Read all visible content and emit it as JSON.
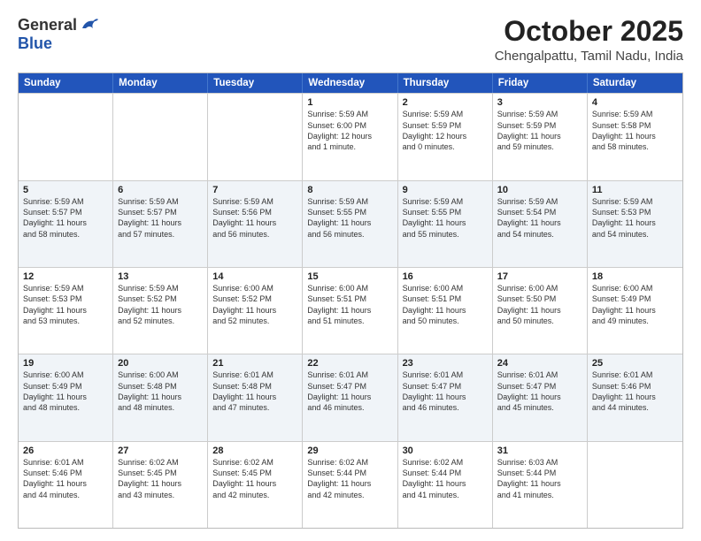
{
  "header": {
    "logo_general": "General",
    "logo_blue": "Blue",
    "month": "October 2025",
    "location": "Chengalpattu, Tamil Nadu, India"
  },
  "days_of_week": [
    "Sunday",
    "Monday",
    "Tuesday",
    "Wednesday",
    "Thursday",
    "Friday",
    "Saturday"
  ],
  "rows": [
    [
      {
        "day": "",
        "info": ""
      },
      {
        "day": "",
        "info": ""
      },
      {
        "day": "",
        "info": ""
      },
      {
        "day": "1",
        "info": "Sunrise: 5:59 AM\nSunset: 6:00 PM\nDaylight: 12 hours\nand 1 minute."
      },
      {
        "day": "2",
        "info": "Sunrise: 5:59 AM\nSunset: 5:59 PM\nDaylight: 12 hours\nand 0 minutes."
      },
      {
        "day": "3",
        "info": "Sunrise: 5:59 AM\nSunset: 5:59 PM\nDaylight: 11 hours\nand 59 minutes."
      },
      {
        "day": "4",
        "info": "Sunrise: 5:59 AM\nSunset: 5:58 PM\nDaylight: 11 hours\nand 58 minutes."
      }
    ],
    [
      {
        "day": "5",
        "info": "Sunrise: 5:59 AM\nSunset: 5:57 PM\nDaylight: 11 hours\nand 58 minutes."
      },
      {
        "day": "6",
        "info": "Sunrise: 5:59 AM\nSunset: 5:57 PM\nDaylight: 11 hours\nand 57 minutes."
      },
      {
        "day": "7",
        "info": "Sunrise: 5:59 AM\nSunset: 5:56 PM\nDaylight: 11 hours\nand 56 minutes."
      },
      {
        "day": "8",
        "info": "Sunrise: 5:59 AM\nSunset: 5:55 PM\nDaylight: 11 hours\nand 56 minutes."
      },
      {
        "day": "9",
        "info": "Sunrise: 5:59 AM\nSunset: 5:55 PM\nDaylight: 11 hours\nand 55 minutes."
      },
      {
        "day": "10",
        "info": "Sunrise: 5:59 AM\nSunset: 5:54 PM\nDaylight: 11 hours\nand 54 minutes."
      },
      {
        "day": "11",
        "info": "Sunrise: 5:59 AM\nSunset: 5:53 PM\nDaylight: 11 hours\nand 54 minutes."
      }
    ],
    [
      {
        "day": "12",
        "info": "Sunrise: 5:59 AM\nSunset: 5:53 PM\nDaylight: 11 hours\nand 53 minutes."
      },
      {
        "day": "13",
        "info": "Sunrise: 5:59 AM\nSunset: 5:52 PM\nDaylight: 11 hours\nand 52 minutes."
      },
      {
        "day": "14",
        "info": "Sunrise: 6:00 AM\nSunset: 5:52 PM\nDaylight: 11 hours\nand 52 minutes."
      },
      {
        "day": "15",
        "info": "Sunrise: 6:00 AM\nSunset: 5:51 PM\nDaylight: 11 hours\nand 51 minutes."
      },
      {
        "day": "16",
        "info": "Sunrise: 6:00 AM\nSunset: 5:51 PM\nDaylight: 11 hours\nand 50 minutes."
      },
      {
        "day": "17",
        "info": "Sunrise: 6:00 AM\nSunset: 5:50 PM\nDaylight: 11 hours\nand 50 minutes."
      },
      {
        "day": "18",
        "info": "Sunrise: 6:00 AM\nSunset: 5:49 PM\nDaylight: 11 hours\nand 49 minutes."
      }
    ],
    [
      {
        "day": "19",
        "info": "Sunrise: 6:00 AM\nSunset: 5:49 PM\nDaylight: 11 hours\nand 48 minutes."
      },
      {
        "day": "20",
        "info": "Sunrise: 6:00 AM\nSunset: 5:48 PM\nDaylight: 11 hours\nand 48 minutes."
      },
      {
        "day": "21",
        "info": "Sunrise: 6:01 AM\nSunset: 5:48 PM\nDaylight: 11 hours\nand 47 minutes."
      },
      {
        "day": "22",
        "info": "Sunrise: 6:01 AM\nSunset: 5:47 PM\nDaylight: 11 hours\nand 46 minutes."
      },
      {
        "day": "23",
        "info": "Sunrise: 6:01 AM\nSunset: 5:47 PM\nDaylight: 11 hours\nand 46 minutes."
      },
      {
        "day": "24",
        "info": "Sunrise: 6:01 AM\nSunset: 5:47 PM\nDaylight: 11 hours\nand 45 minutes."
      },
      {
        "day": "25",
        "info": "Sunrise: 6:01 AM\nSunset: 5:46 PM\nDaylight: 11 hours\nand 44 minutes."
      }
    ],
    [
      {
        "day": "26",
        "info": "Sunrise: 6:01 AM\nSunset: 5:46 PM\nDaylight: 11 hours\nand 44 minutes."
      },
      {
        "day": "27",
        "info": "Sunrise: 6:02 AM\nSunset: 5:45 PM\nDaylight: 11 hours\nand 43 minutes."
      },
      {
        "day": "28",
        "info": "Sunrise: 6:02 AM\nSunset: 5:45 PM\nDaylight: 11 hours\nand 42 minutes."
      },
      {
        "day": "29",
        "info": "Sunrise: 6:02 AM\nSunset: 5:44 PM\nDaylight: 11 hours\nand 42 minutes."
      },
      {
        "day": "30",
        "info": "Sunrise: 6:02 AM\nSunset: 5:44 PM\nDaylight: 11 hours\nand 41 minutes."
      },
      {
        "day": "31",
        "info": "Sunrise: 6:03 AM\nSunset: 5:44 PM\nDaylight: 11 hours\nand 41 minutes."
      },
      {
        "day": "",
        "info": ""
      }
    ]
  ]
}
